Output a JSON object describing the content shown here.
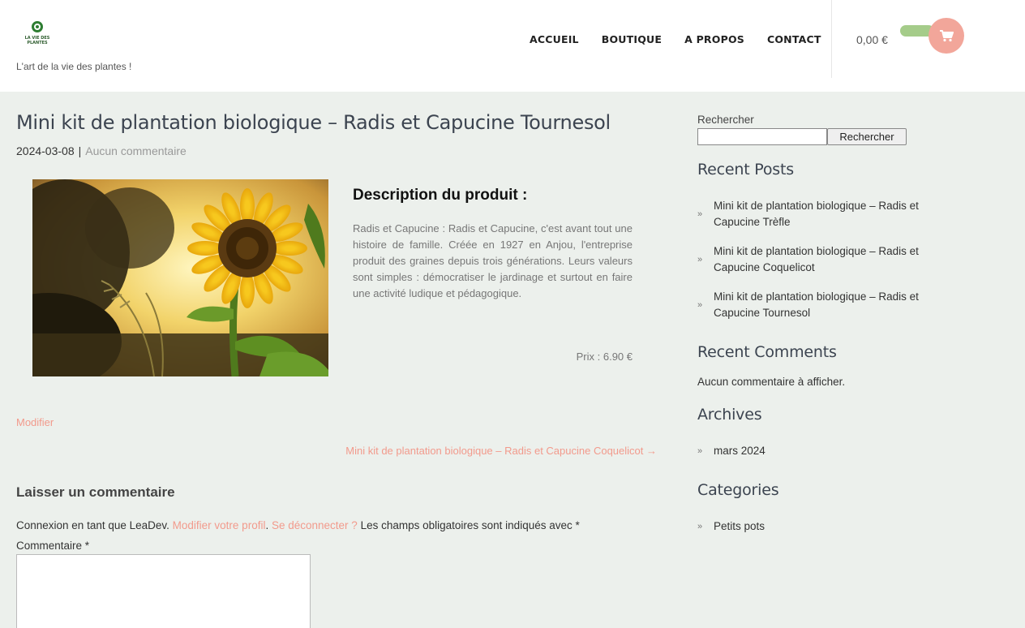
{
  "header": {
    "logo_text": "LA VIE DES PLANTES",
    "tagline": "L'art de la vie des plantes !",
    "nav": [
      "ACCUEIL",
      "BOUTIQUE",
      "A PROPOS",
      "CONTACT"
    ],
    "cart_total": "0,00 €",
    "cart_icon": "shopping-cart-icon",
    "colors": {
      "cart_button": "#f2a69a",
      "cart_pill": "#a5cc8a"
    }
  },
  "post": {
    "title": "Mini kit de plantation biologique – Radis et Capucine Tournesol",
    "date": "2024-03-08",
    "separator": "|",
    "comments_link": "Aucun commentaire",
    "image_alt": "sunflower",
    "description_heading": "Description du produit :",
    "description_text": "Radis et Capucine : Radis et Capucine, c'est avant tout une histoire de famille. Créée en 1927 en Anjou, l'entreprise produit des graines depuis trois générations. Leurs valeurs sont simples : démocratiser le jardinage et surtout en faire une activité ludique et pédagogique.",
    "price": "Prix : 6.90 €",
    "edit_link": "Modifier",
    "next_post": "Mini kit de plantation biologique – Radis et Capucine Coquelicot →"
  },
  "comment_form": {
    "title": "Laisser un commentaire",
    "logged_in_prefix": "Connexion en tant que LeaDev.",
    "edit_profile": "Modifier votre profil",
    "dot": ".",
    "logout": "Se déconnecter ?",
    "required_note": "Les champs obligatoires sont indiqués avec *",
    "comment_label": "Commentaire *",
    "comment_value": ""
  },
  "sidebar": {
    "search_label": "Rechercher",
    "search_value": "",
    "search_button": "Rechercher",
    "recent_posts_title": "Recent Posts",
    "recent_posts": [
      "Mini kit de plantation biologique – Radis et Capucine Trèfle",
      "Mini kit de plantation biologique – Radis et Capucine Coquelicot",
      "Mini kit de plantation biologique – Radis et Capucine Tournesol"
    ],
    "recent_comments_title": "Recent Comments",
    "no_comments": "Aucun commentaire à afficher.",
    "archives_title": "Archives",
    "archives": [
      "mars 2024"
    ],
    "categories_title": "Categories",
    "categories": [
      "Petits pots"
    ],
    "chevron_icon": "double-chevron-right-icon",
    "chevron": "»"
  },
  "colors": {
    "accent_link": "#f29a8c",
    "background": "#ecf0ec",
    "title": "#3c4450"
  }
}
